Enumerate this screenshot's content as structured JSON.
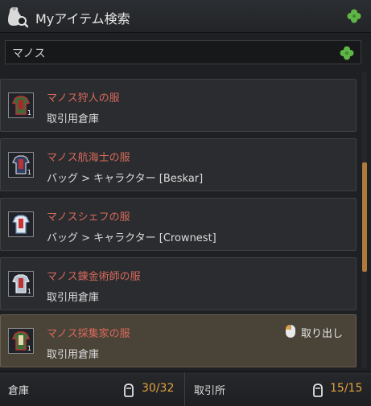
{
  "window": {
    "title": "Myアイテム検索"
  },
  "search": {
    "value": "マノス"
  },
  "items": [
    {
      "name": "マノス狩人の服",
      "location": "取引用倉庫",
      "icon": "green-outfit-icon",
      "qty": "1"
    },
    {
      "name": "マノス航海士の服",
      "location": "バッグ > キャラクター [Beskar]",
      "icon": "blue-outfit-icon",
      "qty": "1"
    },
    {
      "name": "マノスシェフの服",
      "location": "バッグ > キャラクター [Crownest]",
      "icon": "white-outfit-icon",
      "qty": ""
    },
    {
      "name": "マノス錬金術師の服",
      "location": "取引用倉庫",
      "icon": "silver-outfit-icon",
      "qty": "1"
    },
    {
      "name": "マノス採集家の服",
      "location": "取引用倉庫",
      "icon": "green-outfit-icon",
      "qty": "1",
      "action": "取り出し"
    }
  ],
  "footer": {
    "storage_label": "倉庫",
    "storage_count": "30/32",
    "market_label": "取引所",
    "market_count": "15/15"
  },
  "colors": {
    "item_name": "#d86a5a",
    "count": "#e3a33c",
    "scroll_thumb": "#b07a3c"
  }
}
